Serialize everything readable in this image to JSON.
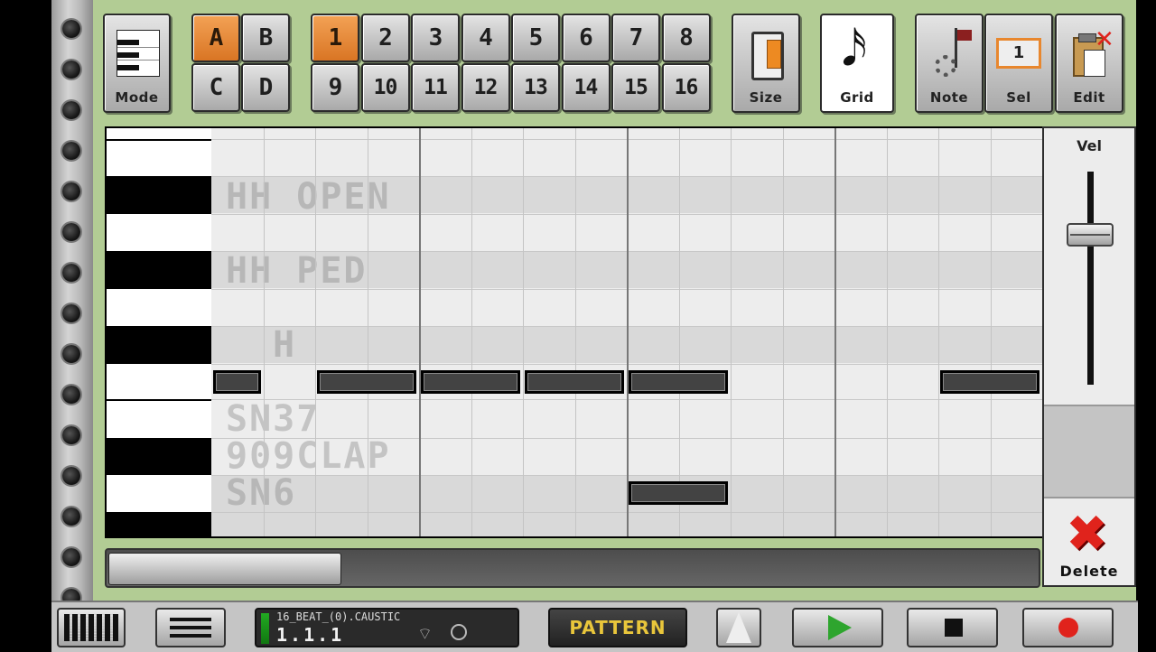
{
  "toolbar": {
    "mode_label": "Mode",
    "banks": [
      {
        "label": "A",
        "active": true
      },
      {
        "label": "B",
        "active": false
      },
      {
        "label": "C",
        "active": false
      },
      {
        "label": "D",
        "active": false
      }
    ],
    "patterns": [
      {
        "label": "1",
        "active": true
      },
      {
        "label": "2",
        "active": false
      },
      {
        "label": "3",
        "active": false
      },
      {
        "label": "4",
        "active": false
      },
      {
        "label": "5",
        "active": false
      },
      {
        "label": "6",
        "active": false
      },
      {
        "label": "7",
        "active": false
      },
      {
        "label": "8",
        "active": false
      },
      {
        "label": "9",
        "active": false
      },
      {
        "label": "10",
        "active": false
      },
      {
        "label": "11",
        "active": false
      },
      {
        "label": "12",
        "active": false
      },
      {
        "label": "13",
        "active": false
      },
      {
        "label": "14",
        "active": false
      },
      {
        "label": "15",
        "active": false
      },
      {
        "label": "16",
        "active": false
      }
    ],
    "size_label": "Size",
    "grid_label": "Grid",
    "note_label": "Note",
    "sel_label": "Sel",
    "sel_value": "1",
    "edit_label": "Edit"
  },
  "lanes": {
    "hh_open": "HH OPEN",
    "hh_ped": "HH PED",
    "hh": "H",
    "sn37": "SN37",
    "clap": "909CLAP",
    "sn6": "SN6"
  },
  "velocity": {
    "label": "Vel",
    "level": 0.27
  },
  "delete_label": "Delete",
  "transport": {
    "song_name": "16_BEAT_(0).CAUSTIC",
    "position": "1.1.1",
    "mode_label": "PATTERN",
    "play_icon": "play-icon",
    "stop_icon": "stop-icon",
    "record_icon": "record-icon"
  },
  "colors": {
    "accent": "#e8872e",
    "background": "#b2cc94",
    "record": "#e0231c",
    "play": "#2ea52e"
  }
}
